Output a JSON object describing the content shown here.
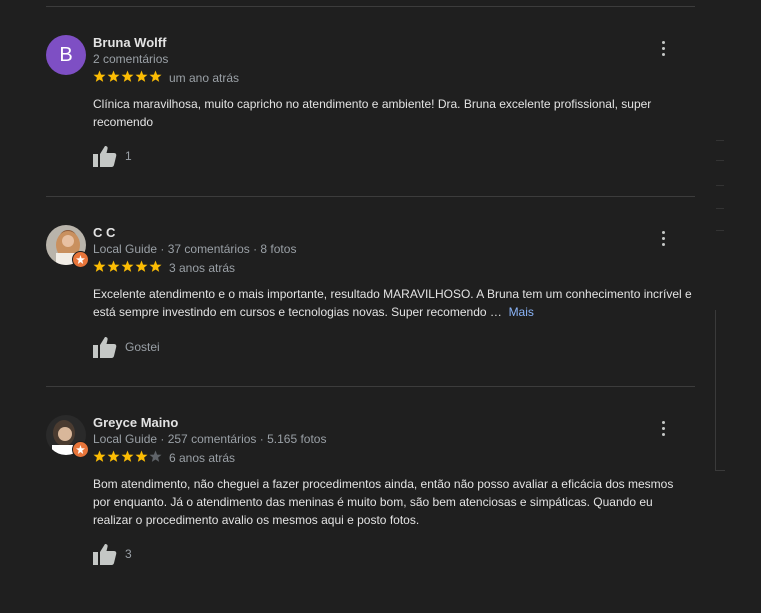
{
  "reviews": [
    {
      "avatar_letter": "B",
      "name": "Bruna Wolff",
      "meta": "2 comentários",
      "rating": 5,
      "when": "um ano atrás",
      "text": "Clínica maravilhosa, muito capricho no atendimento e ambiente! Dra. Bruna excelente profissional, super recomendo",
      "more_label": "",
      "like_label": "1"
    },
    {
      "name": "C C",
      "meta": "Local Guide · 37 comentários · 8 fotos",
      "rating": 5,
      "when": "3 anos atrás",
      "text": "Excelente atendimento e o mais importante, resultado MARAVILHOSO. A Bruna tem um conhecimento incrível e está sempre investindo em cursos e tecnologias novas. Super recomendo …",
      "more_label": "Mais",
      "like_label": "Gostei"
    },
    {
      "name": "Greyce Maino",
      "meta": "Local Guide · 257 comentários · 5.165 fotos",
      "rating": 4,
      "when": "6 anos atrás",
      "text": "Bom atendimento, não cheguei a fazer procedimentos ainda, então não posso avaliar a eficácia dos mesmos por enquanto. Já o atendimento das meninas é muito bom, são bem atenciosas e simpáticas. Quando eu realizar o procedimento avalio os mesmos aqui e posto fotos.",
      "more_label": "",
      "like_label": "3"
    }
  ],
  "colors": {
    "star_filled": "#fbbc04",
    "star_empty": "#5f6368",
    "link": "#8ab4f8",
    "avatar_b": "#7e4fc4",
    "local_guide_badge": "#e8753a"
  },
  "icons": {
    "menu": "more-vert-icon",
    "like": "thumb-up-icon",
    "badge": "local-guide-badge-icon"
  }
}
